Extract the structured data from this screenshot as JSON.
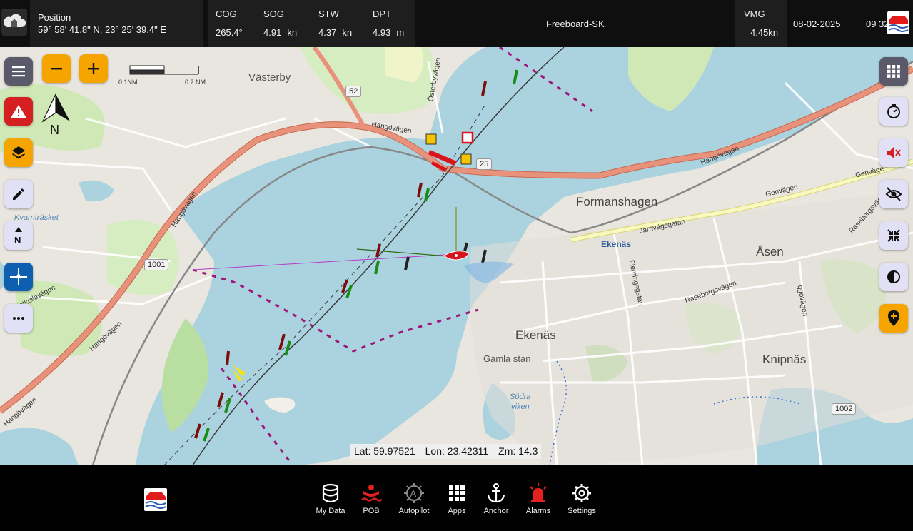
{
  "topbar": {
    "position": {
      "label": "Position",
      "value": "59° 58' 41.8\" N, 23° 25' 39.4\" E"
    },
    "cog": {
      "label": "COG",
      "value": "265.4°"
    },
    "sog": {
      "label": "SOG",
      "value": "4.91",
      "unit": "kn"
    },
    "stw": {
      "label": "STW",
      "value": "4.37",
      "unit": "kn"
    },
    "dpt": {
      "label": "DPT",
      "value": "4.93",
      "unit": "m"
    },
    "server_name": "Freeboard-SK",
    "vmg": {
      "label": "VMG",
      "value": "4.45kn"
    },
    "date": "08-02-2025",
    "time": "09 32",
    "icons": {
      "cloud": "cloud-upload-icon",
      "logo": "freeboard-logo-icon"
    }
  },
  "map": {
    "scale": {
      "left_label": "0.1NM",
      "right_label": "0.2 NM"
    },
    "north_letter": "N",
    "readout": {
      "lat": "Lat: 59.97521",
      "lon": "Lon: 23.42311",
      "zoom": "Zm: 14.3"
    },
    "places": {
      "vasterby": "Västerby",
      "formanshagen": "Formanshagen",
      "asen": "Åsen",
      "ekenas_small": "Ekenäs",
      "ekenas": "Ekenäs",
      "gamla_stan": "Gamla stan",
      "knipnas": "Knipnäs",
      "kvarntrasket": "Kvarnträsket",
      "sodra_viken_1": "Södra",
      "sodra_viken_2": "viken"
    },
    "roads": {
      "hangovagen_1": "Hangövägen",
      "hangovagen_2": "Hangövägen",
      "hangovagen_3": "Hangövägen",
      "hangovagen_4": "Hangövägen",
      "hangovagen_5": "Hangövägen",
      "genvagen_1": "Genvägen",
      "genvagen_2": "Genväge",
      "jarnvagsgatan": "Järnvägsgatan",
      "flemingsgatan": "Flemingsgatan",
      "raseborgsvagen_1": "Raseborgsvägen",
      "raseborgsvagen_2": "Raseborgsväge",
      "osterbyvagen": "Österbyvägen",
      "prastkullavagen": "Prästkullavägen",
      "ggovagen": "ggövägen"
    },
    "shields": {
      "s52": "52",
      "s25": "25",
      "s1001": "1001",
      "s1002": "1002"
    },
    "left_buttons": [
      {
        "name": "menu-button",
        "icon": "hamburger-menu-icon"
      },
      {
        "name": "zoom-out-button",
        "icon": "minus-icon"
      },
      {
        "name": "zoom-in-button",
        "icon": "plus-icon"
      },
      {
        "name": "alarm-warning-button",
        "icon": "warning-triangle-icon"
      },
      {
        "name": "layers-button",
        "icon": "layers-icon"
      },
      {
        "name": "edit-button",
        "icon": "pencil-icon"
      },
      {
        "name": "north-up-button",
        "icon": "north-up-icon"
      },
      {
        "name": "center-vessel-button",
        "icon": "crosshair-vessel-icon"
      },
      {
        "name": "more-button",
        "icon": "more-dots-icon"
      }
    ],
    "right_buttons": [
      {
        "name": "apps-grid-button",
        "icon": "grid-icon"
      },
      {
        "name": "timer-button",
        "icon": "timer-icon"
      },
      {
        "name": "mute-button",
        "icon": "volume-mute-icon"
      },
      {
        "name": "hide-button",
        "icon": "eye-off-icon"
      },
      {
        "name": "collapse-button",
        "icon": "collapse-arrows-icon"
      },
      {
        "name": "contrast-button",
        "icon": "contrast-icon"
      },
      {
        "name": "add-waypoint-button",
        "icon": "add-location-icon"
      }
    ],
    "colors": {
      "water": "#abd3df",
      "land": "#e9e6df",
      "green": "#cfe8b6",
      "motorway": "#e8927c",
      "secondary": "#f7f9c0",
      "route_magenta": "#a0157a",
      "vessel_red": "#d8141c"
    }
  },
  "bottombar": {
    "items": [
      {
        "name": "my-data",
        "label": "My Data",
        "icon": "database-icon",
        "color": "#ffffff"
      },
      {
        "name": "pob",
        "label": "POB",
        "icon": "person-overboard-icon",
        "color": "#e52020"
      },
      {
        "name": "autopilot",
        "label": "Autopilot",
        "icon": "autopilot-icon",
        "color": "#8a8a8a"
      },
      {
        "name": "apps",
        "label": "Apps",
        "icon": "apps-grid-icon",
        "color": "#ffffff"
      },
      {
        "name": "anchor",
        "label": "Anchor",
        "icon": "anchor-icon",
        "color": "#ffffff"
      },
      {
        "name": "alarms",
        "label": "Alarms",
        "icon": "alarm-beacon-icon",
        "color": "#e52020"
      },
      {
        "name": "settings",
        "label": "Settings",
        "icon": "gear-icon",
        "color": "#ffffff"
      }
    ]
  }
}
